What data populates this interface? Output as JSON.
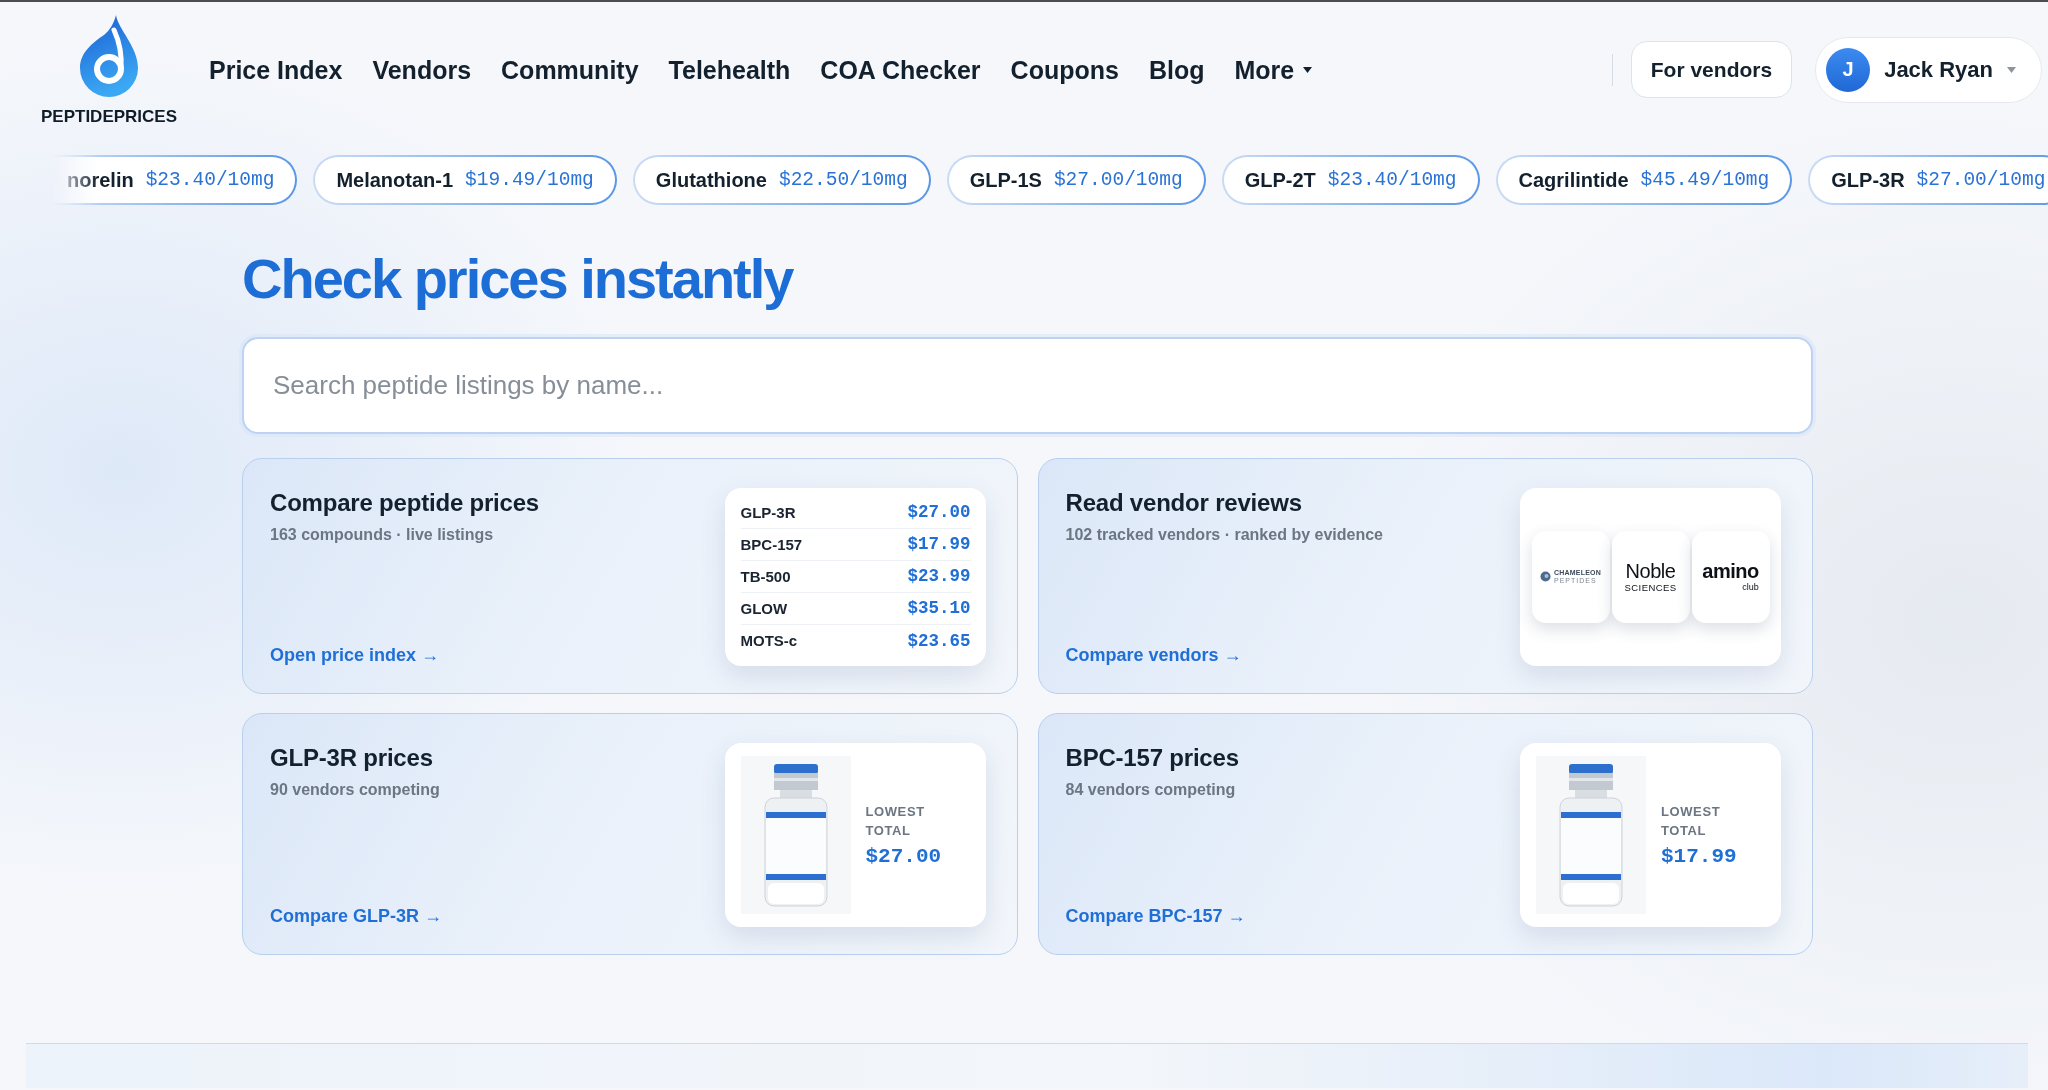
{
  "header": {
    "logo": {
      "wordmark": "PEPTIDEPRICES"
    },
    "nav": [
      {
        "label": "Price Index",
        "dropdown": false
      },
      {
        "label": "Vendors",
        "dropdown": false
      },
      {
        "label": "Community",
        "dropdown": false
      },
      {
        "label": "Telehealth",
        "dropdown": false
      },
      {
        "label": "COA Checker",
        "dropdown": false
      },
      {
        "label": "Coupons",
        "dropdown": false
      },
      {
        "label": "Blog",
        "dropdown": false
      },
      {
        "label": "More",
        "dropdown": true
      }
    ],
    "vendor_button": "For vendors",
    "user": {
      "initial": "J",
      "name": "Jack Ryan"
    }
  },
  "ticker": [
    {
      "name": "norelin",
      "price": "$23.40/10mg"
    },
    {
      "name": "Melanotan-1",
      "price": "$19.49/10mg"
    },
    {
      "name": "Glutathione",
      "price": "$22.50/10mg"
    },
    {
      "name": "GLP-1S",
      "price": "$27.00/10mg"
    },
    {
      "name": "GLP-2T",
      "price": "$23.40/10mg"
    },
    {
      "name": "Cagrilintide",
      "price": "$45.49/10mg"
    },
    {
      "name": "GLP-3R",
      "price": "$27.00/10mg"
    }
  ],
  "hero": {
    "title": "Check prices instantly",
    "search": {
      "placeholder": "Search peptide listings by name..."
    }
  },
  "cards": [
    {
      "kind": "price_table",
      "title": "Compare peptide prices",
      "subtitle": "163 compounds · live listings",
      "link": "Open price index →",
      "rows": [
        {
          "name": "GLP-3R",
          "price": "$27.00"
        },
        {
          "name": "BPC-157",
          "price": "$17.99"
        },
        {
          "name": "TB-500",
          "price": "$23.99"
        },
        {
          "name": "GLOW",
          "price": "$35.10"
        },
        {
          "name": "MOTS-c",
          "price": "$23.65"
        }
      ]
    },
    {
      "kind": "vendor_logos",
      "title": "Read vendor reviews",
      "subtitle": "102 tracked vendors · ranked by evidence",
      "link": "Compare vendors →",
      "logos": [
        {
          "kind": "emblem",
          "name": "CHAMELEON",
          "tagline": "PEPTIDES"
        },
        {
          "kind": "light",
          "name": "Noble",
          "tagline": "SCIENCES"
        },
        {
          "kind": "heavy",
          "name": "amino",
          "tagline": "club"
        }
      ]
    },
    {
      "kind": "product",
      "title": "GLP-3R prices",
      "subtitle": "90 vendors competing",
      "link": "Compare GLP-3R →",
      "label": "LOWEST TOTAL",
      "price": "$27.00"
    },
    {
      "kind": "product",
      "title": "BPC-157 prices",
      "subtitle": "84 vendors competing",
      "link": "Compare BPC-157 →",
      "label": "LOWEST TOTAL",
      "price": "$17.99"
    }
  ]
}
